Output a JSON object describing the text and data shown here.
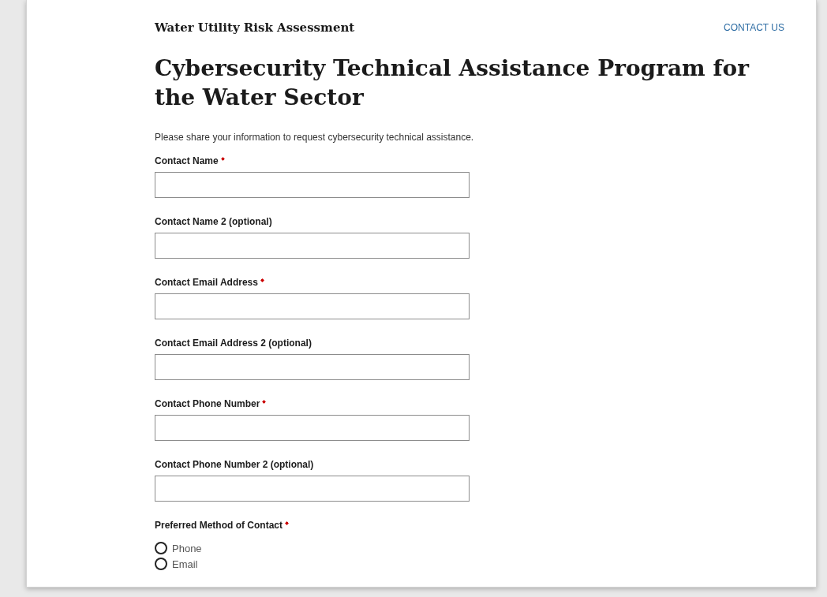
{
  "header": {
    "site_title": "Water Utility Risk Assessment",
    "contact_link": "CONTACT US"
  },
  "title": "Cybersecurity Technical Assistance Program for the Water Sector",
  "intro": "Please share your information to request cybersecurity technical assistance.",
  "fields": [
    {
      "label": "Contact Name",
      "required": true
    },
    {
      "label": "Contact Name 2 (optional)",
      "required": false
    },
    {
      "label": "Contact Email Address",
      "required": true
    },
    {
      "label": "Contact Email Address 2 (optional)",
      "required": false
    },
    {
      "label": "Contact Phone Number",
      "required": true
    },
    {
      "label": "Contact Phone Number 2 (optional)",
      "required": false
    }
  ],
  "preferred_method": {
    "label": "Preferred Method of Contact",
    "required": true,
    "options": [
      {
        "label": "Phone",
        "selected": false
      },
      {
        "label": "Email",
        "selected": false
      }
    ]
  }
}
